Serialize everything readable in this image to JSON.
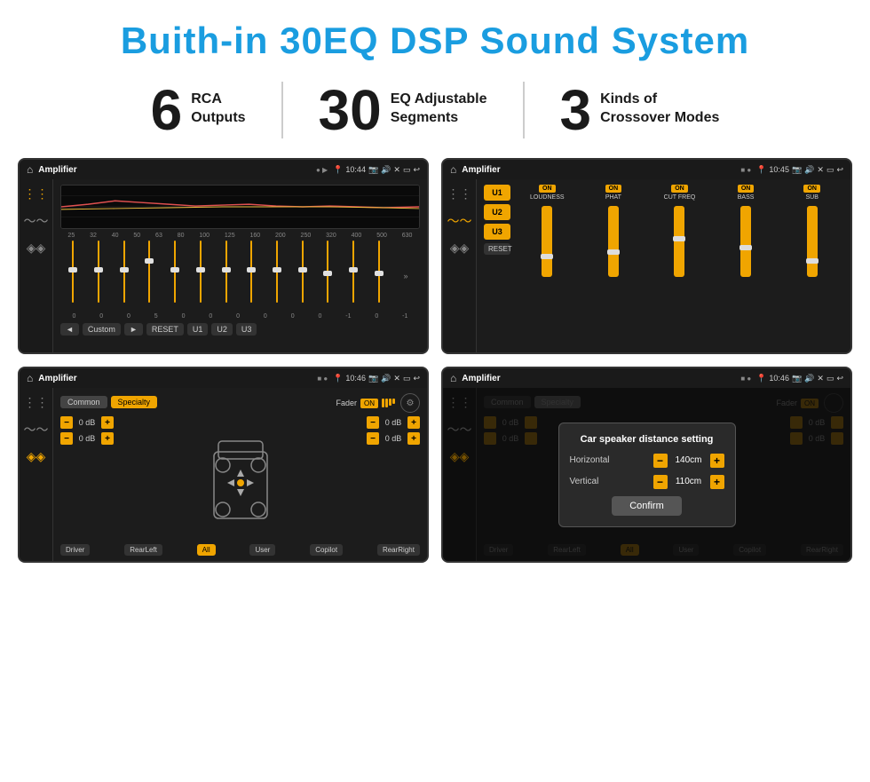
{
  "page": {
    "title": "Buith-in 30EQ DSP Sound System",
    "stats": [
      {
        "number": "6",
        "line1": "RCA",
        "line2": "Outputs"
      },
      {
        "number": "30",
        "line1": "EQ Adjustable",
        "line2": "Segments"
      },
      {
        "number": "3",
        "line1": "Kinds of",
        "line2": "Crossover Modes"
      }
    ]
  },
  "screens": {
    "eq": {
      "app_name": "Amplifier",
      "time": "10:44",
      "freq_labels": [
        "25",
        "32",
        "40",
        "50",
        "63",
        "80",
        "100",
        "125",
        "160",
        "200",
        "250",
        "320",
        "400",
        "500",
        "630"
      ],
      "eq_values": [
        "0",
        "0",
        "0",
        "5",
        "0",
        "0",
        "0",
        "0",
        "0",
        "0",
        "-1",
        "0",
        "-1"
      ],
      "buttons": [
        "◄",
        "Custom",
        "►",
        "RESET",
        "U1",
        "U2",
        "U3"
      ]
    },
    "crossover": {
      "app_name": "Amplifier",
      "time": "10:45",
      "channels": [
        "U1",
        "U2",
        "U3"
      ],
      "controls": [
        {
          "label": "LOUDNESS",
          "on": true
        },
        {
          "label": "PHAT",
          "on": true
        },
        {
          "label": "CUT FREQ",
          "on": true
        },
        {
          "label": "BASS",
          "on": true
        },
        {
          "label": "SUB",
          "on": true
        }
      ],
      "reset_label": "RESET"
    },
    "speaker_fader": {
      "app_name": "Amplifier",
      "time": "10:46",
      "tabs": [
        "Common",
        "Specialty"
      ],
      "active_tab": "Specialty",
      "fader_label": "Fader",
      "fader_on": "ON",
      "vol_rows": [
        {
          "value": "0 dB"
        },
        {
          "value": "0 dB"
        },
        {
          "value": "0 dB"
        },
        {
          "value": "0 dB"
        }
      ],
      "bottom_buttons": [
        "Driver",
        "RearLeft",
        "All",
        "User",
        "Copilot",
        "RearRight"
      ]
    },
    "speaker_distance": {
      "app_name": "Amplifier",
      "time": "10:46",
      "dialog": {
        "title": "Car speaker distance setting",
        "horizontal_label": "Horizontal",
        "horizontal_value": "140cm",
        "vertical_label": "Vertical",
        "vertical_value": "110cm",
        "confirm_label": "Confirm"
      },
      "bottom_buttons": [
        "Driver",
        "RearLeft",
        "All",
        "User",
        "Copilot",
        "RearRight"
      ]
    }
  }
}
